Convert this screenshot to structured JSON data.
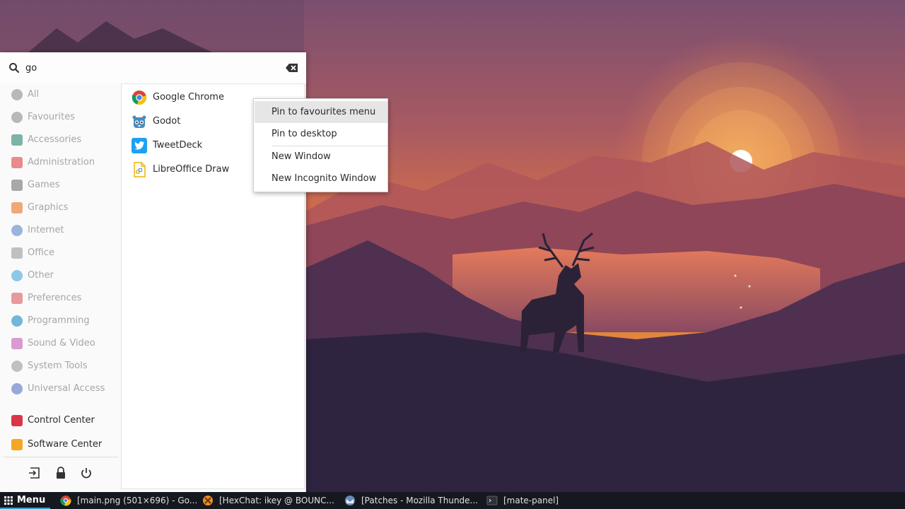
{
  "search": {
    "value": "go"
  },
  "categories": [
    {
      "label": "All",
      "icon": "star-icon",
      "color": "#b8b8b8"
    },
    {
      "label": "Favourites",
      "icon": "heart-icon",
      "color": "#b8b8b8"
    },
    {
      "label": "Accessories",
      "icon": "accessories-icon",
      "color": "#7cb4a8"
    },
    {
      "label": "Administration",
      "icon": "administration-icon",
      "color": "#e88b8b"
    },
    {
      "label": "Games",
      "icon": "gamepad-icon",
      "color": "#a8a8a8"
    },
    {
      "label": "Graphics",
      "icon": "graphics-icon",
      "color": "#f0a878"
    },
    {
      "label": "Internet",
      "icon": "globe-icon",
      "color": "#9ab4dc"
    },
    {
      "label": "Office",
      "icon": "document-icon",
      "color": "#c0c0c0"
    },
    {
      "label": "Other",
      "icon": "download-icon",
      "color": "#8cc8e8"
    },
    {
      "label": "Preferences",
      "icon": "preferences-icon",
      "color": "#e89a9a"
    },
    {
      "label": "Programming",
      "icon": "code-icon",
      "color": "#6fb8d8"
    },
    {
      "label": "Sound & Video",
      "icon": "media-icon",
      "color": "#d89ad0"
    },
    {
      "label": "System Tools",
      "icon": "gear-icon",
      "color": "#c0c0c0"
    },
    {
      "label": "Universal Access",
      "icon": "accessibility-icon",
      "color": "#98a8d8"
    }
  ],
  "system": [
    {
      "label": "Control Center",
      "icon": "control-center-icon",
      "color": "#d9364a"
    },
    {
      "label": "Software Center",
      "icon": "software-center-icon",
      "color": "#f5a623"
    }
  ],
  "actions": [
    "logout-icon",
    "lock-icon",
    "power-icon"
  ],
  "results": [
    {
      "label": "Google Chrome",
      "icon": "chrome-icon"
    },
    {
      "label": "Godot",
      "icon": "godot-icon"
    },
    {
      "label": "TweetDeck",
      "icon": "tweetdeck-icon"
    },
    {
      "label": "LibreOffice Draw",
      "icon": "libreoffice-draw-icon"
    }
  ],
  "context_menu": [
    {
      "label": "Pin to favourites menu",
      "highlighted": true
    },
    {
      "label": "Pin to desktop"
    },
    {
      "label": "New Window"
    },
    {
      "label": "New Incognito Window"
    }
  ],
  "taskbar": {
    "menu_label": "Menu",
    "accent": "#2f9fcf",
    "tasks": [
      {
        "label": "[main.png (501×696) - Go...",
        "icon": "chrome-icon"
      },
      {
        "label": "[HexChat: ikey @ BOUNC...",
        "icon": "hexchat-icon"
      },
      {
        "label": "[Patches - Mozilla Thunde...",
        "icon": "thunderbird-icon"
      },
      {
        "label": "[mate-panel]",
        "icon": "terminal-icon"
      }
    ]
  }
}
